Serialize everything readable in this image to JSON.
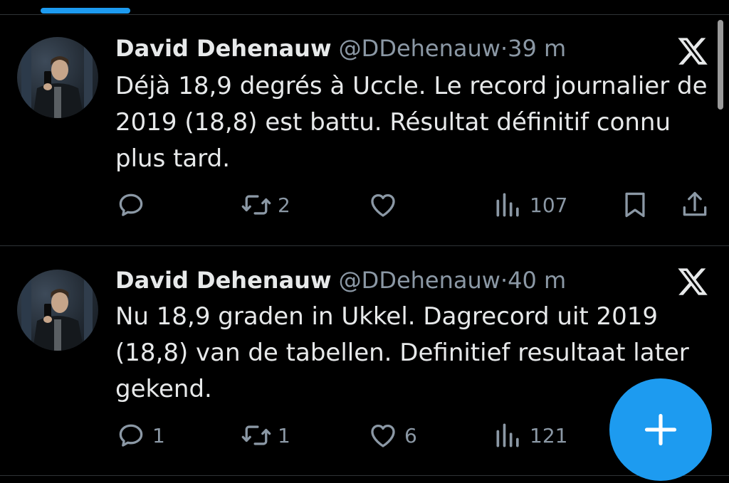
{
  "tweets": [
    {
      "author": "David Dehenauw",
      "handle": "@DDehenauw",
      "separator": "·",
      "time": "39 m",
      "text": "Déjà 18,9 degrés à Uccle. Le record journalier de\n2019 (18,8) est battu. Résultat définitif connu\nplus tard.",
      "replies": "",
      "reposts": "2",
      "likes": "",
      "views": "107"
    },
    {
      "author": "David Dehenauw",
      "handle": "@DDehenauw",
      "separator": "·",
      "time": "40 m",
      "text": "Nu 18,9 graden in Ukkel. Dagrecord uit 2019\n(18,8) van de tabellen. Definitief resultaat later\ngekend.",
      "replies": "1",
      "reposts": "1",
      "likes": "6",
      "views": "121"
    }
  ],
  "icons": {
    "reply": "reply-icon",
    "repost": "repost-icon",
    "like": "heart-icon",
    "views": "views-icon",
    "bookmark": "bookmark-icon",
    "share": "share-icon",
    "platform": "x-logo-icon",
    "compose": "plus-icon"
  },
  "colors": {
    "background": "#000000",
    "text": "#e7e9ea",
    "muted": "#8b98a5",
    "accent": "#1d9bf0",
    "divider": "#2f3336"
  }
}
